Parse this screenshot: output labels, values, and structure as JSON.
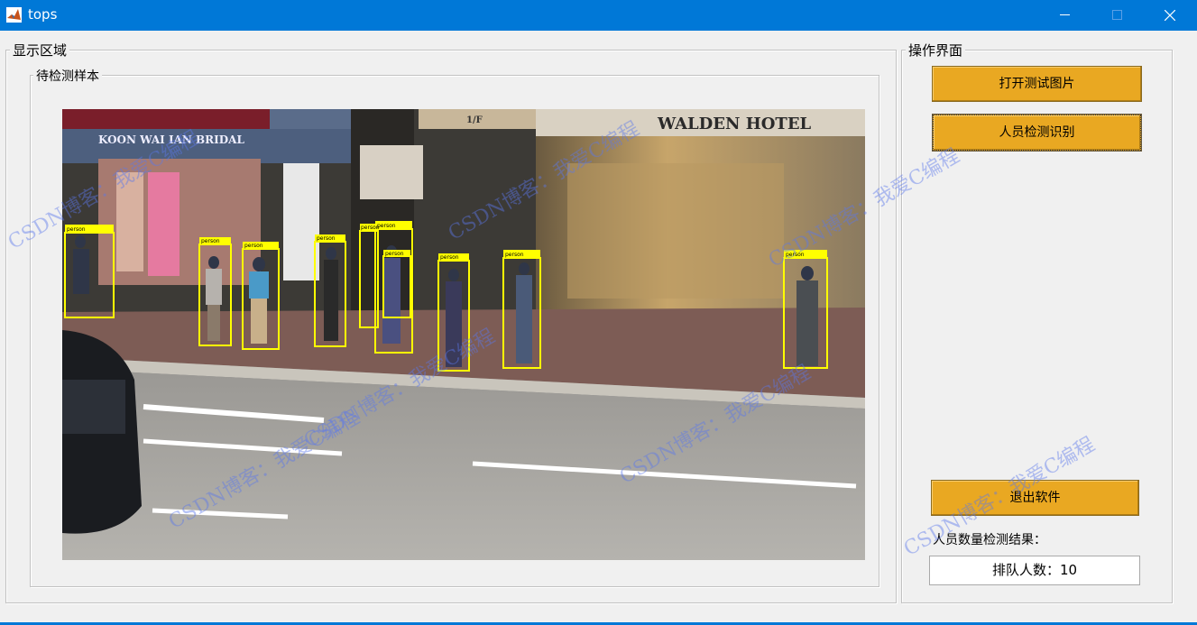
{
  "window": {
    "title": "tops",
    "controls": [
      "minimize-icon",
      "maximize-icon",
      "close-icon"
    ]
  },
  "display_panel": {
    "title": "显示区域",
    "sample_panel": {
      "title": "待检测样本"
    },
    "detections": [
      {
        "label": "person"
      },
      {
        "label": "person"
      },
      {
        "label": "person"
      },
      {
        "label": "person"
      },
      {
        "label": "person"
      },
      {
        "label": "person"
      },
      {
        "label": "person"
      },
      {
        "label": "person"
      },
      {
        "label": "person"
      },
      {
        "label": "person"
      }
    ],
    "storefront_signs": [
      "WALDEN HOTEL",
      "KOON WAI IAN BRIDAL",
      "1/F"
    ]
  },
  "ops_panel": {
    "title": "操作界面",
    "open_button": "打开测试图片",
    "detect_button": "人员检测识别",
    "exit_button": "退出软件",
    "result_label": "人员数量检测结果：",
    "result_value": "排队人数：10"
  },
  "watermark": "CSDN博客：我爱C编程",
  "colors": {
    "titlebar": "#0078d7",
    "button": "#e9a822",
    "bbox": "#ffff00",
    "background": "#f0f0f0"
  }
}
